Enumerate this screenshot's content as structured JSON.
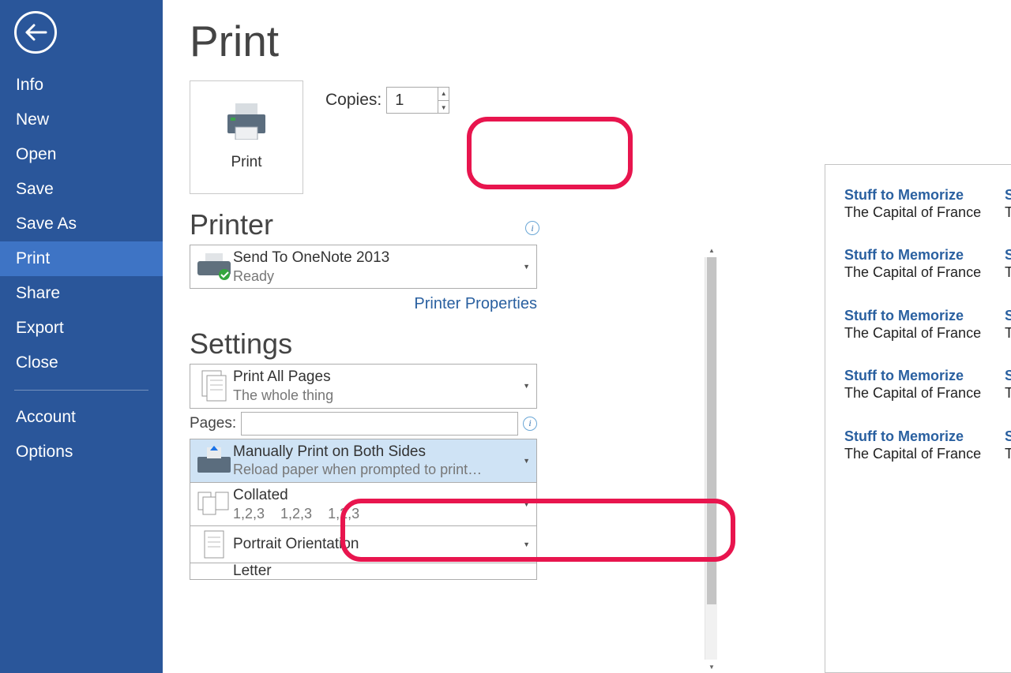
{
  "sidebar": {
    "items": [
      "Info",
      "New",
      "Open",
      "Save",
      "Save As",
      "Print",
      "Share",
      "Export",
      "Close"
    ],
    "account": "Account",
    "options": "Options",
    "selected_index": 5
  },
  "title": "Print",
  "print_button": "Print",
  "copies": {
    "label": "Copies:",
    "value": "1"
  },
  "printer": {
    "heading": "Printer",
    "name": "Send To OneNote 2013",
    "status": "Ready",
    "properties_link": "Printer Properties"
  },
  "settings": {
    "heading": "Settings",
    "print_range": {
      "line1": "Print All Pages",
      "line2": "The whole thing"
    },
    "pages_label": "Pages:",
    "pages_value": "",
    "duplex": {
      "line1": "Manually Print on Both Sides",
      "line2": "Reload paper when prompted to print…"
    },
    "collate": {
      "line1": "Collated",
      "line2": "1,2,3    1,2,3    1,2,3"
    },
    "orientation": {
      "line1": "Portrait Orientation"
    },
    "paper": {
      "line1": "Letter"
    }
  },
  "preview": {
    "cards": [
      {
        "heading": "Stuff to Memorize",
        "body": "The Capital of France"
      },
      {
        "heading": "Stuff to Memorize",
        "body": "The Capital of England"
      },
      {
        "heading": "Stuff to Memorize",
        "body": "The Capital of France"
      },
      {
        "heading": "Stuff to Memorize",
        "body": "The Capital of England"
      },
      {
        "heading": "Stuff to Memorize",
        "body": "The Capital of France"
      },
      {
        "heading": "Stuff to Memorize",
        "body": "The Capital of England"
      },
      {
        "heading": "Stuff to Memorize",
        "body": "The Capital of France"
      },
      {
        "heading": "Stuff to Memorize",
        "body": "The Capital of England"
      },
      {
        "heading": "Stuff to Memorize",
        "body": "The Capital of France"
      },
      {
        "heading": "Stuff to Memorize",
        "body": "The Capital of England"
      }
    ]
  }
}
